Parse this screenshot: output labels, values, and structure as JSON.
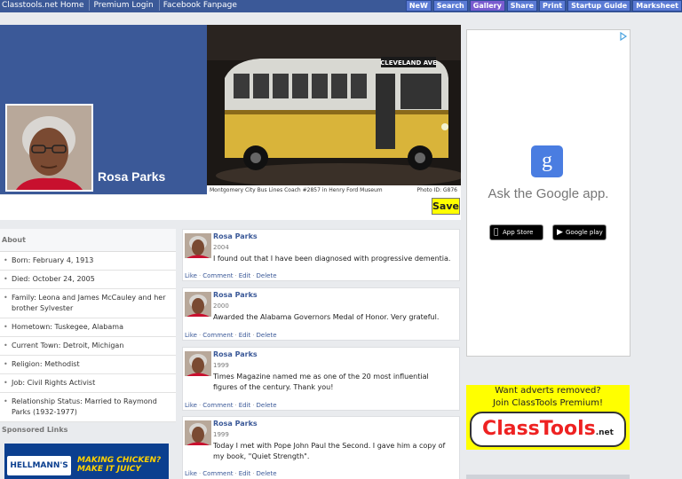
{
  "topbar": {
    "nav": [
      "Classtools.net Home",
      "Premium Login",
      "Facebook Fanpage"
    ],
    "tools": [
      "NeW",
      "Search",
      "Gallery",
      "Share",
      "Print",
      "Startup Guide",
      "Marksheet"
    ]
  },
  "profile": {
    "name": "Rosa Parks"
  },
  "cover": {
    "sign": "CLEVELAND AVE",
    "caption": "Montgomery City Bus Lines Coach #2857 in Henry Ford Museum",
    "photo_id": "Photo ID: G876"
  },
  "save_label": "Save",
  "about": {
    "heading": "About",
    "items": [
      "Born: February 4, 1913",
      "Died: October 24, 2005",
      "Family: Leona and James McCauley and her brother Sylvester",
      "Hometown: Tuskegee, Alabama",
      "Current Town: Detroit, Michigan",
      "Religion: Methodist",
      "Job: Civil Rights Activist",
      "Relationship Status: Married to Raymond Parks (1932-1977)"
    ]
  },
  "sponsored": {
    "heading": "Sponsored Links",
    "brand": "HELLMANN'S",
    "slogan_1": "MAKING CHICKEN?",
    "slogan_2": "MAKE IT JUICY"
  },
  "posts": [
    {
      "author": "Rosa Parks",
      "year": "2004",
      "text": "I found out that I have been diagnosed with progressive dementia."
    },
    {
      "author": "Rosa Parks",
      "year": "2000",
      "text": "Awarded the Alabama Governors Medal of Honor. Very grateful."
    },
    {
      "author": "Rosa Parks",
      "year": "1999",
      "text": "Times Magazine named me as one of the 20 most influential figures of the century. Thank you!"
    },
    {
      "author": "Rosa Parks",
      "year": "1999",
      "text": "Today I met with Pope John Paul the Second. I gave him a copy of my book, \"Quiet Strength\"."
    }
  ],
  "post_actions": [
    "Like",
    "Comment",
    "Edit",
    "Delete"
  ],
  "google_ad": {
    "logo_letter": "g",
    "headline": "Ask the Google app.",
    "app_store": "App Store",
    "google_play": "Google play"
  },
  "classtools_ad": {
    "line1": "Want adverts removed?",
    "line2": "Join ClassTools Premium!",
    "logo": "ClassTools",
    "logo_suffix": ".net"
  }
}
